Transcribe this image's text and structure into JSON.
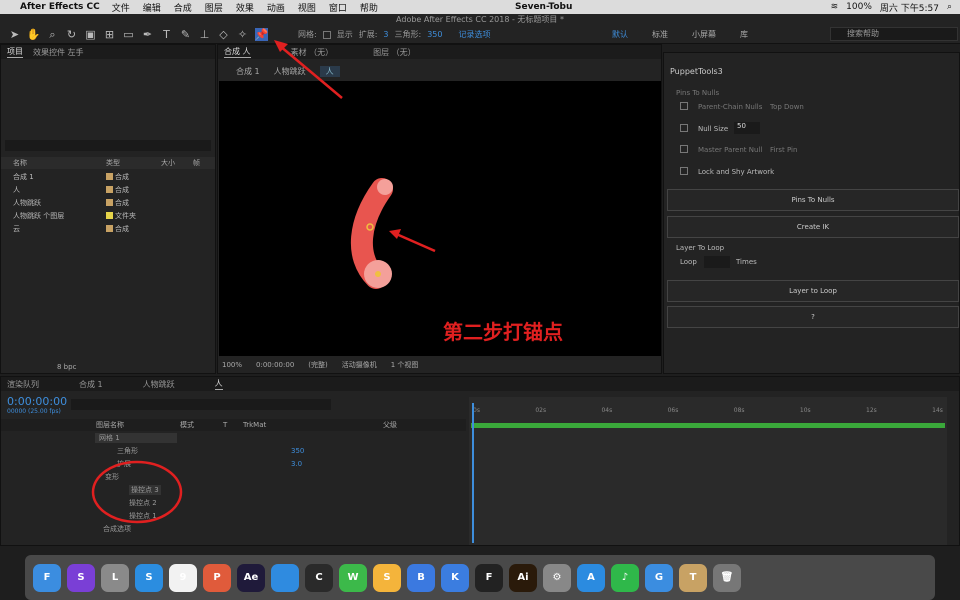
{
  "menubar": {
    "app": "After Effects CC",
    "items": [
      "文件",
      "编辑",
      "合成",
      "图层",
      "效果",
      "动画",
      "视图",
      "窗口",
      "帮助"
    ],
    "user": "Seven-Tobu",
    "battery": "100%",
    "clock": "周六 下午5:57"
  },
  "window": {
    "title": "Adobe After Effects CC 2018 - 无标题项目 *"
  },
  "toolbar": {
    "grid": "网格:",
    "show": "显示",
    "expand": "扩展:",
    "expand_val": "3",
    "tri": "三角形:",
    "tri_val": "350",
    "record": "记录选项",
    "workspaces": [
      "默认",
      "标准",
      "小屏幕",
      "库"
    ],
    "search": "搜索帮助"
  },
  "project": {
    "tabs": [
      "项目",
      "效果控件 左手"
    ],
    "cols": [
      "名称",
      "类型",
      "大小",
      "帧"
    ],
    "items": [
      {
        "name": "合成 1",
        "type": "合成",
        "color": "#c8a264"
      },
      {
        "name": "人",
        "type": "合成",
        "color": "#c8a264"
      },
      {
        "name": "人物跳跃",
        "type": "合成",
        "color": "#c8a264"
      },
      {
        "name": "人物跳跃 个图层",
        "type": "文件夹",
        "color": "#e6d44a"
      },
      {
        "name": "云",
        "type": "合成",
        "color": "#c8a264"
      }
    ],
    "bpc": "8 bpc"
  },
  "comp": {
    "tab": "合成 人",
    "footage": "素材 （无）",
    "layer": "图层 （无）",
    "crumbs": [
      "合成 1",
      "人物跳跃",
      "人"
    ],
    "zoom": "100%",
    "time": "0:00:00:00",
    "quality": "(完整)",
    "camera": "活动摄像机",
    "views": "1 个视图"
  },
  "annotation": "第二步打锚点",
  "puppet": {
    "title": "PuppetTools3",
    "section1": "Pins To Nulls",
    "opt1": "Parent-Chain Nulls",
    "opt1b": "Top Down",
    "opt2": "Null Size",
    "opt2_val": "50",
    "opt3": "Master Parent Null",
    "opt3b": "First Pin",
    "opt4": "Lock and Shy Artwork",
    "btn1": "Pins To Nulls",
    "btn2": "Create IK",
    "section2": "Layer To Loop",
    "loop": "Loop",
    "times": "Times",
    "btn3": "Layer to Loop",
    "btn4": "?"
  },
  "timeline": {
    "tabs": [
      "渲染队列",
      "合成 1",
      "人物跳跃",
      "人"
    ],
    "time": "0:00:00:00",
    "fps": "00000 (25.00 fps)",
    "header": [
      "图层名称",
      "模式",
      "T",
      "TrkMat",
      "父级"
    ],
    "rows": [
      {
        "label": "网格 1",
        "indent": 94
      },
      {
        "label": "三角形",
        "indent": 116,
        "val": "350"
      },
      {
        "label": "扩展",
        "indent": 116,
        "val": "3.0"
      },
      {
        "label": "变形",
        "indent": 104
      },
      {
        "label": "操控点 3",
        "indent": 128
      },
      {
        "label": "操控点 2",
        "indent": 128
      },
      {
        "label": "操控点 1",
        "indent": 128
      },
      {
        "label": "合成选项",
        "indent": 94
      }
    ],
    "ruler": [
      "0s",
      "02s",
      "04s",
      "06s",
      "08s",
      "10s",
      "12s",
      "14s"
    ]
  },
  "dock": [
    {
      "name": "finder",
      "color": "#3b8de0",
      "t": "F"
    },
    {
      "name": "siri",
      "color": "#7a3fd6",
      "t": "S"
    },
    {
      "name": "launchpad",
      "color": "#8a8a8a",
      "t": "L"
    },
    {
      "name": "safari",
      "color": "#2b8de0",
      "t": "S"
    },
    {
      "name": "calendar",
      "color": "#f2f2f2",
      "t": "9"
    },
    {
      "name": "photos",
      "color": "#e05b3b",
      "t": "P"
    },
    {
      "name": "ae",
      "color": "#1f1a3a",
      "t": "Ae"
    },
    {
      "name": "app",
      "color": "#2f8be0",
      "t": ""
    },
    {
      "name": "c4d",
      "color": "#2a2a2a",
      "t": "C"
    },
    {
      "name": "wechat",
      "color": "#3cb94a",
      "t": "W"
    },
    {
      "name": "sketch",
      "color": "#f4b43b",
      "t": "S"
    },
    {
      "name": "baidu",
      "color": "#3b79e0",
      "t": "B"
    },
    {
      "name": "keynote",
      "color": "#3b7de0",
      "t": "K"
    },
    {
      "name": "finalcut",
      "color": "#222",
      "t": "F"
    },
    {
      "name": "ai",
      "color": "#2a1a0a",
      "t": "Ai"
    },
    {
      "name": "prefs",
      "color": "#888",
      "t": "⚙"
    },
    {
      "name": "appstore",
      "color": "#2b8be0",
      "t": "A"
    },
    {
      "name": "music",
      "color": "#2fb84a",
      "t": "♪"
    },
    {
      "name": "browser",
      "color": "#3b8de0",
      "t": "G"
    },
    {
      "name": "tool",
      "color": "#c8a264",
      "t": "T"
    },
    {
      "name": "trash",
      "color": "#777",
      "t": "🗑"
    }
  ]
}
